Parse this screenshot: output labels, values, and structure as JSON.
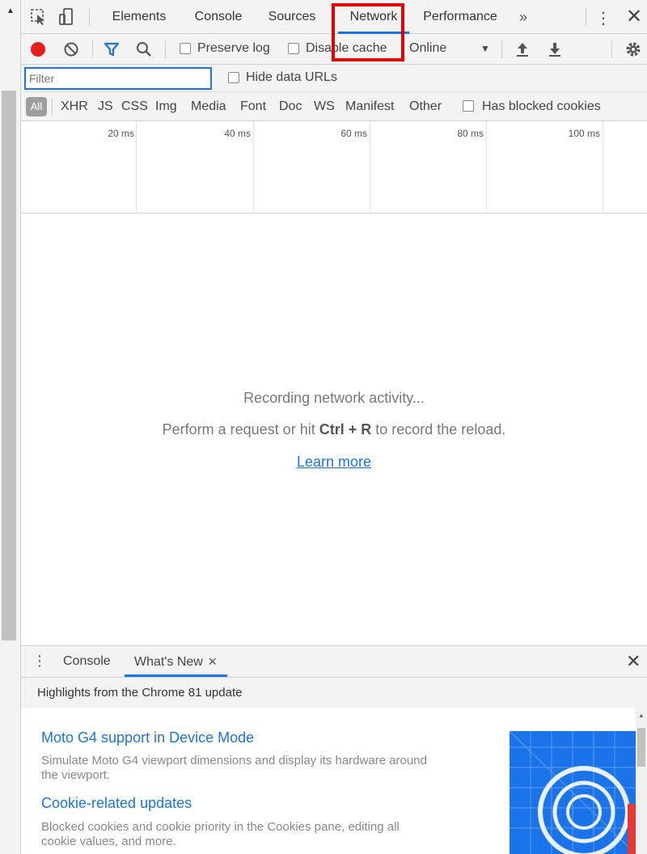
{
  "tabs": [
    {
      "label": "Elements"
    },
    {
      "label": "Console"
    },
    {
      "label": "Sources"
    },
    {
      "label": "Network"
    },
    {
      "label": "Performance"
    }
  ],
  "more_tabs": "»",
  "toolbar": {
    "preserve_log": "Preserve log",
    "disable_cache": "Disable cache",
    "throttling": "Online"
  },
  "filter": {
    "placeholder": "Filter",
    "hide_data_urls": "Hide data URLs"
  },
  "types": [
    "All",
    "XHR",
    "JS",
    "CSS",
    "Img",
    "Media",
    "Font",
    "Doc",
    "WS",
    "Manifest",
    "Other"
  ],
  "has_blocked_cookies": "Has blocked cookies",
  "timeline_ticks": [
    "20 ms",
    "40 ms",
    "60 ms",
    "80 ms",
    "100 ms"
  ],
  "empty": {
    "recording": "Recording network activity...",
    "hint_prefix": "Perform a request or hit ",
    "hint_keys": "Ctrl + R",
    "hint_suffix": " to record the reload.",
    "learn_more": "Learn more"
  },
  "drawer": {
    "tabs": [
      {
        "label": "Console"
      },
      {
        "label": "What's New"
      }
    ],
    "highlights": "Highlights from the Chrome 81 update",
    "items": [
      {
        "title": "Moto G4 support in Device Mode",
        "desc": "Simulate Moto G4 viewport dimensions and display its hardware around the viewport."
      },
      {
        "title": "Cookie-related updates",
        "desc": "Blocked cookies and cookie priority in the Cookies pane, editing all cookie values, and more."
      }
    ]
  },
  "colors": {
    "record": "#e81d1d",
    "accent": "#1a73e8",
    "highlight_box": "#e00000"
  }
}
